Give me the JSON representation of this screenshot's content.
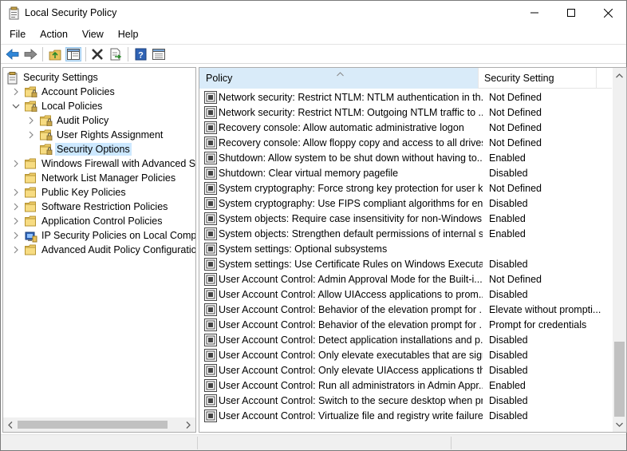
{
  "window": {
    "title": "Local Security Policy"
  },
  "menu": [
    "File",
    "Action",
    "View",
    "Help"
  ],
  "toolbar": {
    "buttons": [
      "back-icon",
      "forward-icon",
      "up-folder-icon",
      "show-hide-tree-icon",
      "delete-icon",
      "export-list-icon",
      "help-icon",
      "properties-icon"
    ]
  },
  "tree": {
    "items": [
      {
        "label": "Security Settings",
        "level": 0,
        "state": "expanded",
        "icon": "security-settings-icon"
      },
      {
        "label": "Account Policies",
        "level": 1,
        "state": "collapsed",
        "icon": "locked-folder-icon"
      },
      {
        "label": "Local Policies",
        "level": 1,
        "state": "expanded",
        "icon": "locked-folder-icon"
      },
      {
        "label": "Audit Policy",
        "level": 2,
        "state": "collapsed",
        "icon": "locked-folder-icon"
      },
      {
        "label": "User Rights Assignment",
        "level": 2,
        "state": "collapsed",
        "icon": "locked-folder-icon"
      },
      {
        "label": "Security Options",
        "level": 2,
        "state": "none",
        "icon": "locked-folder-icon",
        "selected": true
      },
      {
        "label": "Windows Firewall with Advanced Security",
        "level": 1,
        "state": "collapsed",
        "icon": "folder-icon"
      },
      {
        "label": "Network List Manager Policies",
        "level": 1,
        "state": "none",
        "icon": "folder-icon"
      },
      {
        "label": "Public Key Policies",
        "level": 1,
        "state": "collapsed",
        "icon": "folder-icon"
      },
      {
        "label": "Software Restriction Policies",
        "level": 1,
        "state": "collapsed",
        "icon": "folder-icon"
      },
      {
        "label": "Application Control Policies",
        "level": 1,
        "state": "collapsed",
        "icon": "folder-icon"
      },
      {
        "label": "IP Security Policies on Local Computer",
        "level": 1,
        "state": "collapsed",
        "icon": "ip-security-icon"
      },
      {
        "label": "Advanced Audit Policy Configuration",
        "level": 1,
        "state": "collapsed",
        "icon": "folder-icon"
      }
    ]
  },
  "list": {
    "columns": {
      "policy": "Policy",
      "setting": "Security Setting"
    },
    "rows": [
      {
        "policy": "Network security: Restrict NTLM: NTLM authentication in th...",
        "setting": "Not Defined"
      },
      {
        "policy": "Network security: Restrict NTLM: Outgoing NTLM traffic to ...",
        "setting": "Not Defined"
      },
      {
        "policy": "Recovery console: Allow automatic administrative logon",
        "setting": "Not Defined"
      },
      {
        "policy": "Recovery console: Allow floppy copy and access to all drives...",
        "setting": "Not Defined"
      },
      {
        "policy": "Shutdown: Allow system to be shut down without having to...",
        "setting": "Enabled"
      },
      {
        "policy": "Shutdown: Clear virtual memory pagefile",
        "setting": "Disabled"
      },
      {
        "policy": "System cryptography: Force strong key protection for user k...",
        "setting": "Not Defined"
      },
      {
        "policy": "System cryptography: Use FIPS compliant algorithms for en...",
        "setting": "Disabled"
      },
      {
        "policy": "System objects: Require case insensitivity for non-Windows ...",
        "setting": "Enabled"
      },
      {
        "policy": "System objects: Strengthen default permissions of internal s...",
        "setting": "Enabled"
      },
      {
        "policy": "System settings: Optional subsystems",
        "setting": ""
      },
      {
        "policy": "System settings: Use Certificate Rules on Windows Executabl...",
        "setting": "Disabled"
      },
      {
        "policy": "User Account Control: Admin Approval Mode for the Built-i...",
        "setting": "Not Defined"
      },
      {
        "policy": "User Account Control: Allow UIAccess applications to prom...",
        "setting": "Disabled"
      },
      {
        "policy": "User Account Control: Behavior of the elevation prompt for ...",
        "setting": "Elevate without prompti..."
      },
      {
        "policy": "User Account Control: Behavior of the elevation prompt for ...",
        "setting": "Prompt for credentials"
      },
      {
        "policy": "User Account Control: Detect application installations and p...",
        "setting": "Disabled"
      },
      {
        "policy": "User Account Control: Only elevate executables that are sign...",
        "setting": "Disabled"
      },
      {
        "policy": "User Account Control: Only elevate UIAccess applications th...",
        "setting": "Disabled"
      },
      {
        "policy": "User Account Control: Run all administrators in Admin Appr...",
        "setting": "Enabled"
      },
      {
        "policy": "User Account Control: Switch to the secure desktop when pr...",
        "setting": "Disabled"
      },
      {
        "policy": "User Account Control: Virtualize file and registry write failure...",
        "setting": "Disabled"
      }
    ]
  },
  "colors": {
    "selection": "#cce8ff",
    "header_sorted": "#d9ebf9",
    "accent": "#0078d7"
  }
}
